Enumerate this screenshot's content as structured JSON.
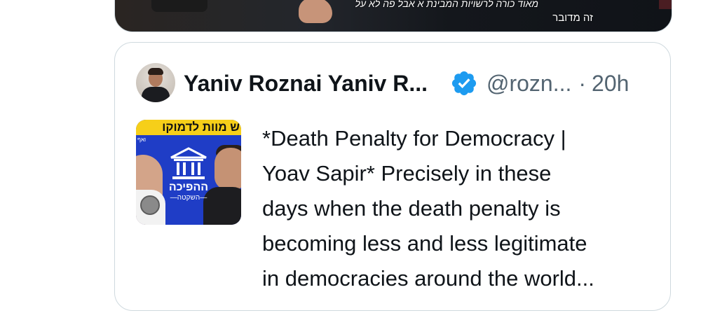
{
  "media_card": {
    "caption_line1": "מאוד כורה לרשויות המבינת א אבל פה לא על",
    "caption_line2": "זה מדובר"
  },
  "quoted_tweet": {
    "display_name": "Yaniv Roznai Yaniv R...",
    "handle": "@rozn...",
    "separator": "·",
    "time": "20h",
    "verified_icon": "verified-badge-icon",
    "verified_color": "#1d9bf0",
    "thumbnail": {
      "banner_text": "ש מוות לדמוקו",
      "tag_text": "ואף",
      "logo_text": "ההפיכה",
      "logo_subtext": "—השקטה—"
    },
    "text_lines": [
      "*Death Penalty for Democracy |",
      "Yoav Sapir* Precisely in these",
      "days when the death penalty is",
      "becoming less and less legitimate",
      "in democracies around the world..."
    ]
  }
}
